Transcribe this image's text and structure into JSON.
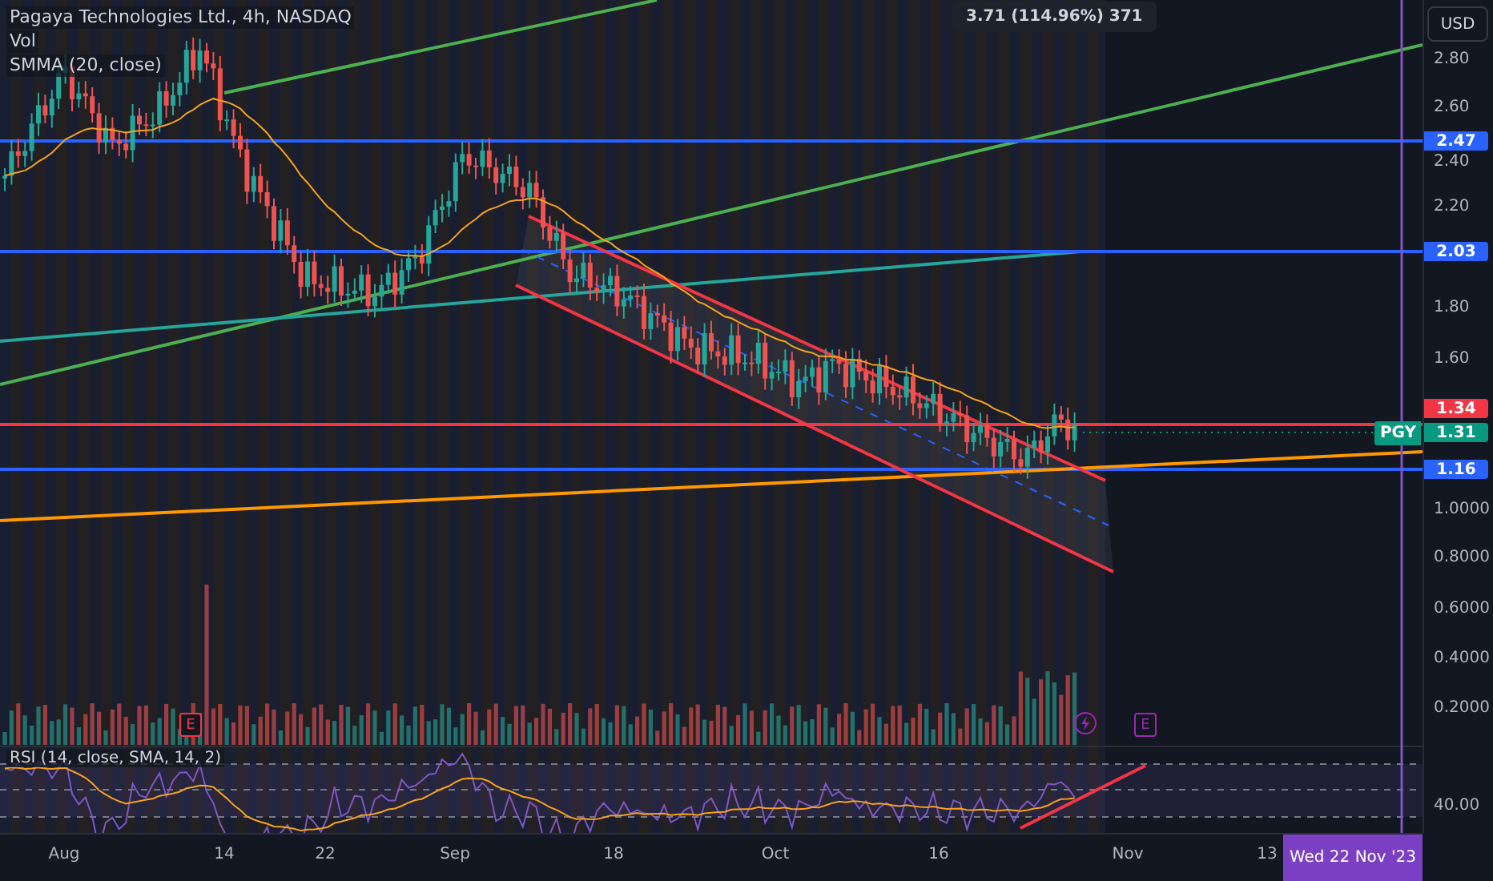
{
  "legend": {
    "title": "Pagaya Technologies Ltd., 4h, NASDAQ",
    "indicators": [
      "Vol",
      "SMMA (20, close)"
    ]
  },
  "measure": "3.71 (114.96%) 371",
  "price_axis": {
    "currency": "USD",
    "ticks": [
      "2.80",
      "2.60",
      "2.40",
      "2.20",
      "1.80",
      "1.60",
      "1.0000",
      "0.8000",
      "0.6000",
      "0.4000",
      "0.2000"
    ],
    "labels": [
      {
        "text": "2.47",
        "kind": "level"
      },
      {
        "text": "2.03",
        "kind": "level"
      },
      {
        "text": "1.34",
        "kind": "alert"
      },
      {
        "text": "1.31",
        "kind": "last"
      },
      {
        "text": "1.16",
        "kind": "level"
      }
    ]
  },
  "last_symbol": "PGY",
  "events": [
    {
      "kind": "earnings",
      "label": "E",
      "color": "#f23645"
    },
    {
      "kind": "split"
    },
    {
      "kind": "earnings",
      "label": "E",
      "color": "#9c27b0"
    }
  ],
  "rsi": {
    "label": "RSI (14, close, SMA, 14, 2)",
    "ticks": [
      "40.00"
    ]
  },
  "time_axis": {
    "ticks": [
      "Aug",
      "14",
      "22",
      "Sep",
      "18",
      "Oct",
      "16",
      "Nov",
      "13"
    ],
    "crosshair": "Wed 22 Nov '23"
  }
}
